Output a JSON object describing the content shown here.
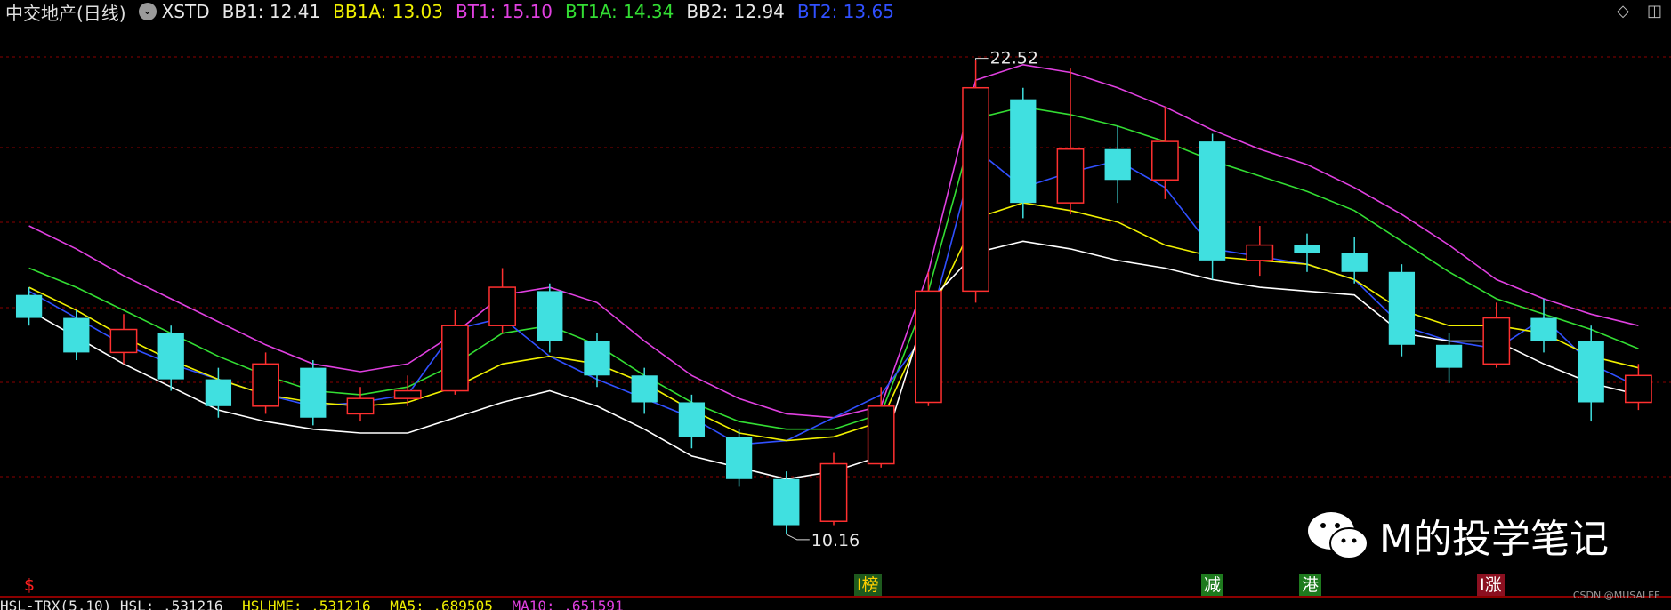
{
  "header": {
    "stock_name": "中交地产(日线)",
    "indicator_name": "XSTD",
    "values": [
      {
        "label": "BB1: 12.41",
        "color": "#e8e8e8"
      },
      {
        "label": "BB1A: 13.03",
        "color": "#f0f000"
      },
      {
        "label": "BT1: 15.10",
        "color": "#e040e0"
      },
      {
        "label": "BT1A: 14.34",
        "color": "#33dd33"
      },
      {
        "label": "BB2: 12.94",
        "color": "#e8e8e8"
      },
      {
        "label": "BT2: 13.65",
        "color": "#3050ff"
      }
    ]
  },
  "annotations": {
    "high": "22.52",
    "low": "10.16"
  },
  "tags": [
    {
      "text": "$",
      "color": "#ff2020",
      "bg": "#000000"
    },
    {
      "text": "I榜",
      "color": "#ffd000",
      "bg": "#1e5a1e"
    },
    {
      "text": "减",
      "color": "#ffffff",
      "bg": "#1e7a1e"
    },
    {
      "text": "港",
      "color": "#ffffff",
      "bg": "#1e7a1e"
    },
    {
      "text": "I涨",
      "color": "#ffffff",
      "bg": "#8b1020"
    }
  ],
  "bottom": [
    {
      "text": "HSL-TRX(5,10) HSL: .531216",
      "color": "#e8e8e8"
    },
    {
      "text": "HSLHME: .531216",
      "color": "#f0f000"
    },
    {
      "text": "MA5: .689505",
      "color": "#f0f000"
    },
    {
      "text": "MA10: .651591",
      "color": "#e040e0"
    }
  ],
  "watermark": {
    "text": "M的投学笔记"
  },
  "credit": "CSDN @MUSALEE",
  "colors": {
    "up": "#ff3030",
    "down": "#40e0e0",
    "bb1": "#ffffff",
    "bb1a": "#f0f000",
    "bt1": "#e040e0",
    "bt1a": "#33dd33",
    "bt2": "#3050ff",
    "grid": "#8b0000"
  },
  "chart_data": {
    "type": "candlestick",
    "ylim": [
      9.3,
      23.3
    ],
    "series": [
      {
        "name": "BT1",
        "values": [
          18.2,
          17.6,
          16.9,
          16.3,
          15.7,
          15.1,
          14.6,
          14.4,
          14.6,
          15.4,
          16.4,
          16.6,
          16.2,
          15.2,
          14.3,
          13.7,
          13.3,
          13.2,
          13.5,
          17.0,
          22.0,
          22.4,
          22.2,
          21.8,
          21.3,
          20.7,
          20.2,
          19.8,
          19.2,
          18.5,
          17.7,
          16.8,
          16.3,
          15.9,
          15.6
        ]
      },
      {
        "name": "BT1A",
        "values": [
          17.1,
          16.6,
          16.0,
          15.4,
          14.8,
          14.3,
          13.9,
          13.8,
          14.0,
          14.6,
          15.4,
          15.6,
          15.1,
          14.3,
          13.6,
          13.1,
          12.9,
          12.9,
          13.3,
          16.5,
          21.0,
          21.3,
          21.1,
          20.8,
          20.4,
          19.9,
          19.5,
          19.1,
          18.6,
          17.8,
          17.0,
          16.3,
          15.9,
          15.5,
          15.0
        ]
      },
      {
        "name": "BT2",
        "values": [
          16.5,
          15.8,
          15.1,
          14.6,
          14.2,
          13.8,
          13.5,
          13.6,
          13.8,
          15.5,
          15.8,
          14.8,
          14.2,
          13.7,
          13.2,
          12.5,
          12.6,
          13.2,
          13.8,
          15.5,
          20.2,
          19.2,
          19.6,
          19.9,
          19.2,
          17.6,
          17.4,
          17.2,
          16.8,
          15.6,
          15.2,
          15.0,
          15.8,
          14.6,
          14.0
        ]
      },
      {
        "name": "BB1A",
        "values": [
          16.6,
          16.0,
          15.3,
          14.7,
          14.2,
          13.8,
          13.6,
          13.5,
          13.6,
          14.0,
          14.6,
          14.8,
          14.6,
          14.1,
          13.4,
          12.8,
          12.6,
          12.7,
          13.1,
          15.8,
          18.4,
          18.8,
          18.6,
          18.3,
          17.7,
          17.4,
          17.3,
          17.2,
          16.8,
          16.0,
          15.6,
          15.6,
          15.4,
          14.8,
          14.5
        ]
      },
      {
        "name": "BB1",
        "values": [
          16.0,
          15.3,
          14.6,
          14.0,
          13.4,
          13.1,
          12.9,
          12.8,
          12.8,
          13.2,
          13.6,
          13.9,
          13.5,
          12.9,
          12.2,
          11.9,
          11.6,
          11.8,
          12.2,
          16.2,
          17.5,
          17.8,
          17.6,
          17.3,
          17.1,
          16.8,
          16.6,
          16.5,
          16.4,
          15.4,
          15.2,
          15.2,
          14.6,
          14.1,
          13.8
        ]
      }
    ],
    "candles": [
      [
        16.4,
        15.8,
        16.6,
        15.6
      ],
      [
        15.8,
        14.9,
        16.0,
        14.7
      ],
      [
        14.9,
        15.5,
        15.9,
        14.6
      ],
      [
        15.4,
        14.2,
        15.6,
        13.9
      ],
      [
        14.2,
        13.5,
        14.5,
        13.2
      ],
      [
        13.5,
        14.6,
        14.9,
        13.3
      ],
      [
        14.5,
        13.2,
        14.7,
        13.0
      ],
      [
        13.3,
        13.7,
        14.0,
        13.1
      ],
      [
        13.7,
        13.9,
        14.3,
        13.5
      ],
      [
        13.9,
        15.6,
        16.0,
        13.8
      ],
      [
        15.6,
        16.6,
        17.1,
        15.4
      ],
      [
        16.5,
        15.2,
        16.7,
        14.9
      ],
      [
        15.2,
        14.3,
        15.4,
        14.0
      ],
      [
        14.3,
        13.6,
        14.5,
        13.3
      ],
      [
        13.6,
        12.7,
        13.8,
        12.4
      ],
      [
        12.7,
        11.6,
        12.9,
        11.4
      ],
      [
        11.6,
        10.4,
        11.8,
        10.16
      ],
      [
        10.5,
        12.0,
        12.3,
        10.4
      ],
      [
        12.0,
        13.5,
        14.0,
        11.9
      ],
      [
        13.6,
        16.5,
        17.0,
        13.5
      ],
      [
        16.5,
        21.8,
        22.52,
        16.2
      ],
      [
        21.5,
        18.8,
        21.8,
        18.4
      ],
      [
        18.8,
        20.2,
        22.3,
        18.5
      ],
      [
        20.2,
        19.4,
        20.8,
        18.8
      ],
      [
        19.4,
        20.4,
        21.3,
        18.9
      ],
      [
        20.4,
        17.3,
        20.6,
        16.8
      ],
      [
        17.3,
        17.7,
        18.2,
        16.9
      ],
      [
        17.7,
        17.5,
        18.0,
        17.0
      ],
      [
        17.5,
        17.0,
        17.9,
        16.7
      ],
      [
        17.0,
        15.1,
        17.2,
        14.8
      ],
      [
        15.1,
        14.5,
        15.4,
        14.1
      ],
      [
        14.6,
        15.8,
        16.2,
        14.5
      ],
      [
        15.8,
        15.2,
        16.3,
        14.9
      ],
      [
        15.2,
        13.6,
        15.6,
        13.1
      ],
      [
        13.6,
        14.3,
        14.6,
        13.4
      ]
    ]
  }
}
